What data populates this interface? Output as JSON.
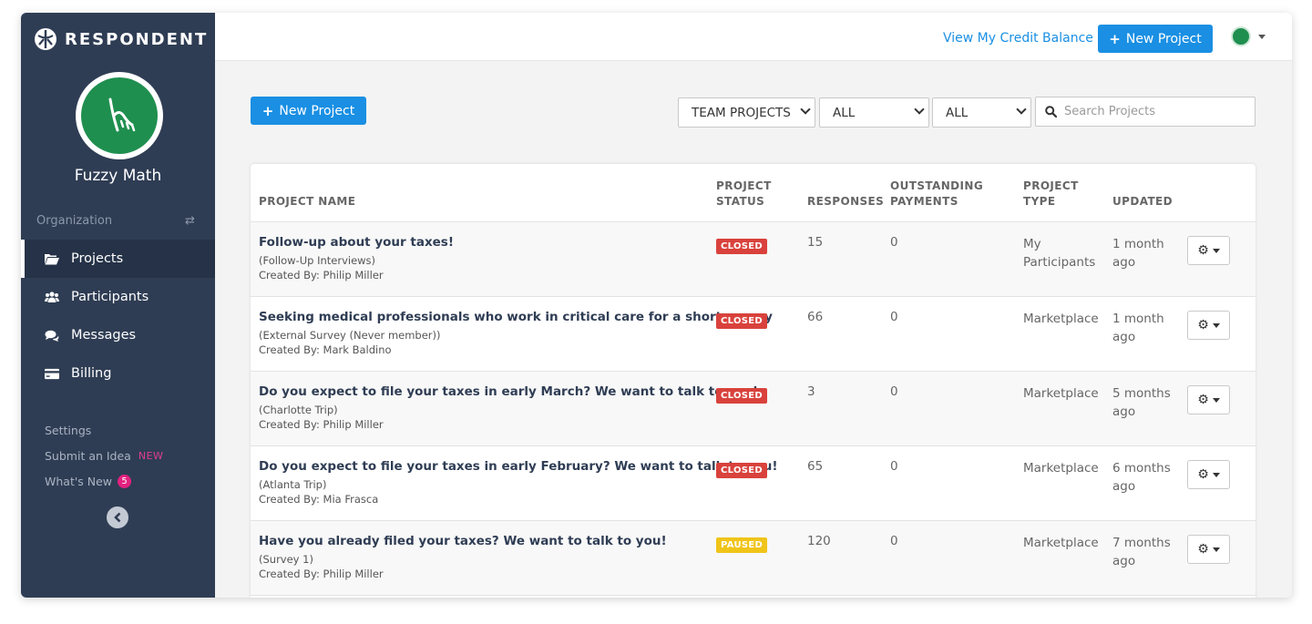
{
  "brand": {
    "name": "RESPONDENT"
  },
  "org": {
    "name": "Fuzzy Math",
    "label": "Organization"
  },
  "nav": [
    {
      "label": "Projects",
      "icon": "folder-open-icon",
      "active": true
    },
    {
      "label": "Participants",
      "icon": "users-icon",
      "active": false
    },
    {
      "label": "Messages",
      "icon": "comments-icon",
      "active": false
    },
    {
      "label": "Billing",
      "icon": "credit-card-icon",
      "active": false
    }
  ],
  "side_links": {
    "settings": "Settings",
    "submit_idea": "Submit an Idea",
    "new_tag": "NEW",
    "whats_new": "What's New",
    "whats_new_count": "5"
  },
  "topbar": {
    "credit_link": "View My Credit Balance",
    "new_project": "New Project"
  },
  "toolbar": {
    "new_project": "New Project",
    "filter_scope": "TEAM PROJECTS",
    "filter_status": "ALL",
    "filter_type": "ALL",
    "search_placeholder": "Search Projects"
  },
  "table": {
    "headers": {
      "name": "PROJECT NAME",
      "status_1": "PROJECT",
      "status_2": "STATUS",
      "responses": "RESPONSES",
      "payments_1": "OUTSTANDING",
      "payments_2": "PAYMENTS",
      "type_1": "PROJECT",
      "type_2": "TYPE",
      "updated": "UPDATED"
    },
    "rows": [
      {
        "name": "Follow-up about your taxes!",
        "subtitle": "(Follow-Up Interviews)",
        "created_by": "Created By: Philip Miller",
        "status": "CLOSED",
        "responses": "15",
        "payments": "0",
        "type_1": "My",
        "type_2": "Participants",
        "updated_1": "1 month",
        "updated_2": "ago"
      },
      {
        "name": "Seeking medical professionals who work in critical care for a short survey",
        "subtitle": "(External Survey (Never member))",
        "created_by": "Created By: Mark Baldino",
        "status": "CLOSED",
        "responses": "66",
        "payments": "0",
        "type_1": "Marketplace",
        "type_2": "",
        "updated_1": "1 month",
        "updated_2": "ago"
      },
      {
        "name": "Do you expect to file your taxes in early March? We want to talk to you!",
        "subtitle": "(Charlotte Trip)",
        "created_by": "Created By: Philip Miller",
        "status": "CLOSED",
        "responses": "3",
        "payments": "0",
        "type_1": "Marketplace",
        "type_2": "",
        "updated_1": "5 months",
        "updated_2": "ago"
      },
      {
        "name": "Do you expect to file your taxes in early February? We want to talk to you!",
        "subtitle": "(Atlanta Trip)",
        "created_by": "Created By: Mia Frasca",
        "status": "CLOSED",
        "responses": "65",
        "payments": "0",
        "type_1": "Marketplace",
        "type_2": "",
        "updated_1": "6 months",
        "updated_2": "ago"
      },
      {
        "name": "Have you already filed your taxes? We want to talk to you!",
        "subtitle": "(Survey 1)",
        "created_by": "Created By: Philip Miller",
        "status": "PAUSED",
        "responses": "120",
        "payments": "0",
        "type_1": "Marketplace",
        "type_2": "",
        "updated_1": "7 months",
        "updated_2": "ago"
      }
    ]
  },
  "colors": {
    "sidebar": "#2f3d54",
    "accent": "#1a8fe3",
    "closed": "#d9423c",
    "paused": "#f0c419",
    "brand_green": "#1f8f4f"
  }
}
